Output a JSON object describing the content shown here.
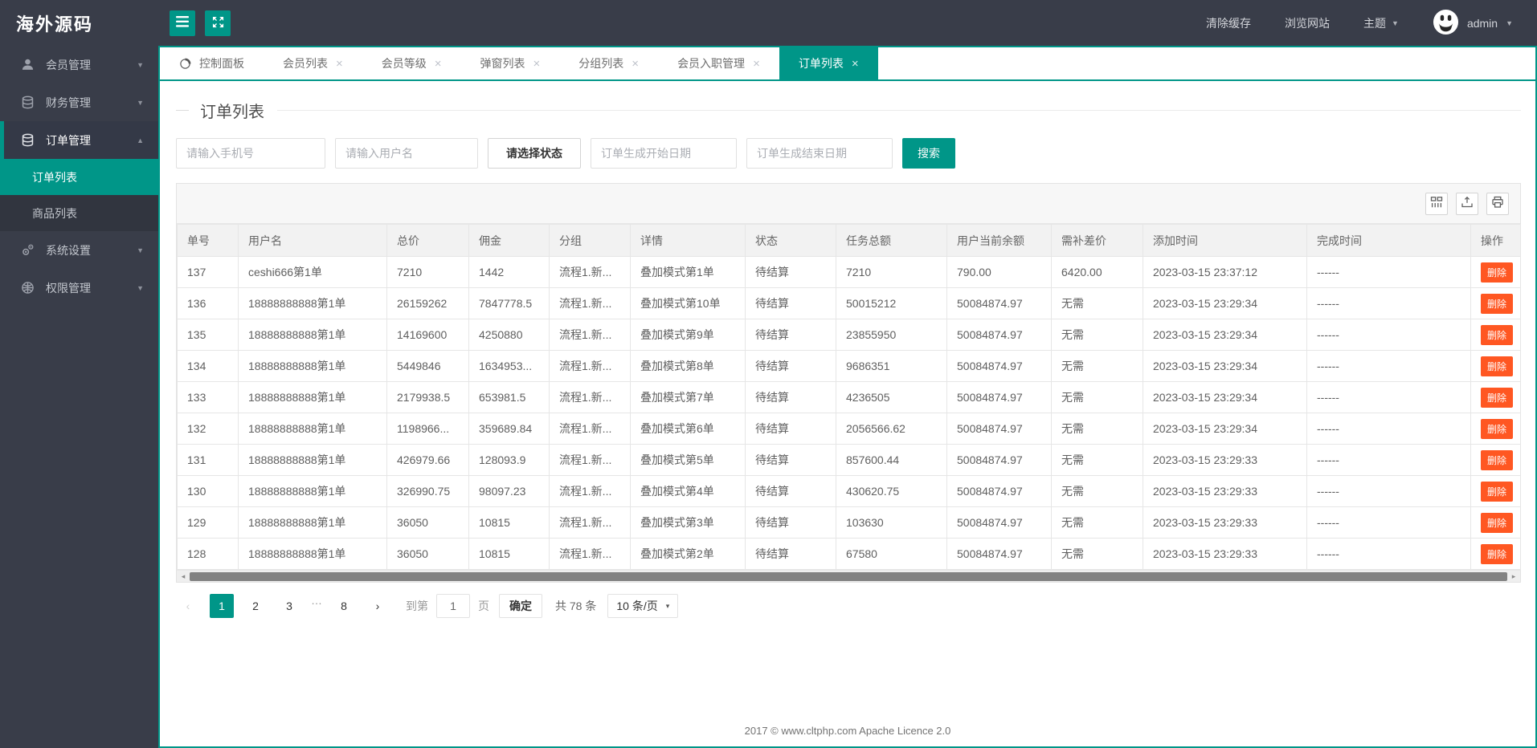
{
  "brand": "海外源码",
  "colors": {
    "accent": "#009688",
    "danger": "#FF5722",
    "chrome_bg": "#393D49"
  },
  "icons": {
    "prev": "‹",
    "next": "›",
    "scroll_left": "◂",
    "scroll_right": "▸",
    "caret_down": "▼",
    "caret_up": "▲",
    "select_caret": "▾",
    "close": "×"
  },
  "header": {
    "clear_cache": "清除缓存",
    "browse_site": "浏览网站",
    "theme": "主题",
    "username": "admin"
  },
  "sidebar": {
    "items": [
      {
        "key": "members",
        "label": "会员管理",
        "icon": "user-icon",
        "expanded": false,
        "active": false
      },
      {
        "key": "finance",
        "label": "财务管理",
        "icon": "finance-icon",
        "expanded": false,
        "active": false
      },
      {
        "key": "orders",
        "label": "订单管理",
        "icon": "orders-icon",
        "expanded": true,
        "active": true,
        "children": [
          {
            "key": "order-list",
            "label": "订单列表",
            "active": true
          },
          {
            "key": "goods-list",
            "label": "商品列表",
            "active": false
          }
        ]
      },
      {
        "key": "settings",
        "label": "系统设置",
        "icon": "settings-icon",
        "expanded": false,
        "active": false
      },
      {
        "key": "permissions",
        "label": "权限管理",
        "icon": "permissions-icon",
        "expanded": false,
        "active": false
      }
    ]
  },
  "tabs": [
    {
      "key": "dashboard",
      "label": "控制面板",
      "icon": "dashboard-icon",
      "closable": false,
      "active": false
    },
    {
      "key": "member-list",
      "label": "会员列表",
      "closable": true,
      "active": false
    },
    {
      "key": "member-level",
      "label": "会员等级",
      "closable": true,
      "active": false
    },
    {
      "key": "popup-list",
      "label": "弹窗列表",
      "closable": true,
      "active": false
    },
    {
      "key": "group-list",
      "label": "分组列表",
      "closable": true,
      "active": false
    },
    {
      "key": "member-entry",
      "label": "会员入职管理",
      "closable": true,
      "active": false
    },
    {
      "key": "order-list",
      "label": "订单列表",
      "closable": true,
      "active": true
    }
  ],
  "page": {
    "title": "订单列表"
  },
  "filters": {
    "phone_placeholder": "请输入手机号",
    "username_placeholder": "请输入用户名",
    "status_label": "请选择状态",
    "start_date_placeholder": "订单生成开始日期",
    "end_date_placeholder": "订单生成结束日期",
    "search_label": "搜索"
  },
  "table": {
    "columns": [
      "单号",
      "用户名",
      "总价",
      "佣金",
      "分组",
      "详情",
      "状态",
      "任务总额",
      "用户当前余额",
      "需补差价",
      "添加时间",
      "完成时间",
      "操作"
    ],
    "column_keys": [
      "order-id",
      "username",
      "total-price",
      "commission",
      "group",
      "detail",
      "status",
      "task-total",
      "user-balance",
      "diff-price",
      "created-at",
      "finished-at",
      "action"
    ],
    "action_label": "删除",
    "rows": [
      [
        "137",
        "ceshi666第1单",
        "7210",
        "1442",
        "流程1.新...",
        "叠加模式第1单",
        "待结算",
        "7210",
        "790.00",
        "6420.00",
        "2023-03-15 23:37:12",
        "------"
      ],
      [
        "136",
        "18888888888第1单",
        "26159262",
        "7847778.5",
        "流程1.新...",
        "叠加模式第10单",
        "待结算",
        "50015212",
        "50084874.97",
        "无需",
        "2023-03-15 23:29:34",
        "------"
      ],
      [
        "135",
        "18888888888第1单",
        "14169600",
        "4250880",
        "流程1.新...",
        "叠加模式第9单",
        "待结算",
        "23855950",
        "50084874.97",
        "无需",
        "2023-03-15 23:29:34",
        "------"
      ],
      [
        "134",
        "18888888888第1单",
        "5449846",
        "1634953...",
        "流程1.新...",
        "叠加模式第8单",
        "待结算",
        "9686351",
        "50084874.97",
        "无需",
        "2023-03-15 23:29:34",
        "------"
      ],
      [
        "133",
        "18888888888第1单",
        "2179938.5",
        "653981.5",
        "流程1.新...",
        "叠加模式第7单",
        "待结算",
        "4236505",
        "50084874.97",
        "无需",
        "2023-03-15 23:29:34",
        "------"
      ],
      [
        "132",
        "18888888888第1单",
        "1198966...",
        "359689.84",
        "流程1.新...",
        "叠加模式第6单",
        "待结算",
        "2056566.62",
        "50084874.97",
        "无需",
        "2023-03-15 23:29:34",
        "------"
      ],
      [
        "131",
        "18888888888第1单",
        "426979.66",
        "128093.9",
        "流程1.新...",
        "叠加模式第5单",
        "待结算",
        "857600.44",
        "50084874.97",
        "无需",
        "2023-03-15 23:29:33",
        "------"
      ],
      [
        "130",
        "18888888888第1单",
        "326990.75",
        "98097.23",
        "流程1.新...",
        "叠加模式第4单",
        "待结算",
        "430620.75",
        "50084874.97",
        "无需",
        "2023-03-15 23:29:33",
        "------"
      ],
      [
        "129",
        "18888888888第1单",
        "36050",
        "10815",
        "流程1.新...",
        "叠加模式第3单",
        "待结算",
        "103630",
        "50084874.97",
        "无需",
        "2023-03-15 23:29:33",
        "------"
      ],
      [
        "128",
        "18888888888第1单",
        "36050",
        "10815",
        "流程1.新...",
        "叠加模式第2单",
        "待结算",
        "67580",
        "50084874.97",
        "无需",
        "2023-03-15 23:29:33",
        "------"
      ]
    ]
  },
  "pagination": {
    "pages": [
      "1",
      "2",
      "3",
      "…",
      "8"
    ],
    "active_page": "1",
    "goto_prefix": "到第",
    "goto_value": "1",
    "goto_suffix": "页",
    "confirm_label": "确定",
    "total_text": "共 78 条",
    "page_size": "10 条/页"
  },
  "footer": {
    "text": "2017 ©  www.cltphp.com  Apache Licence 2.0"
  }
}
